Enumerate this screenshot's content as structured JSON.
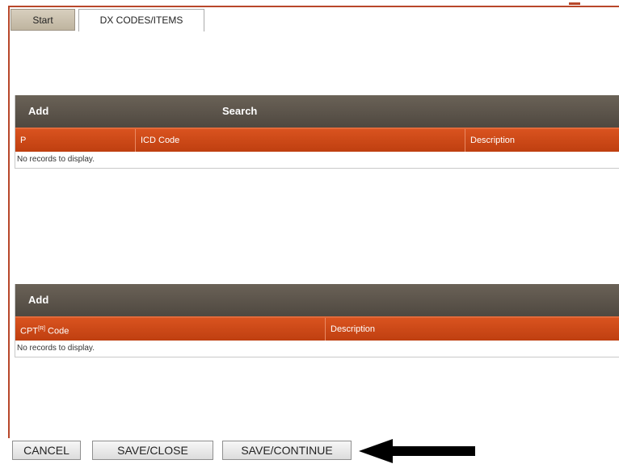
{
  "tabs": [
    {
      "label": "Start",
      "active": false
    },
    {
      "label": "DX CODES/ITEMS",
      "active": true
    }
  ],
  "dx_grid": {
    "toolbar": {
      "add_label": "Add",
      "search_label": "Search"
    },
    "columns": [
      "P",
      "ICD Code",
      "Description"
    ],
    "empty_message": "No records to display."
  },
  "cpt_grid": {
    "toolbar": {
      "add_label": "Add"
    },
    "columns": {
      "code_prefix": "CPT",
      "code_sup": "[R]",
      "code_suffix": " Code",
      "description": "Description"
    },
    "empty_message": "No records to display."
  },
  "buttons": {
    "cancel": "CANCEL",
    "save_close": "SAVE/CLOSE",
    "save_continue": "SAVE/CONTINUE"
  },
  "annotation": {
    "arrow_icon": "left-arrow-icon",
    "color": "#000000"
  },
  "colors": {
    "toolbar": "#5a5249",
    "header": "#c9481a",
    "border_accent": "#b8472a"
  }
}
